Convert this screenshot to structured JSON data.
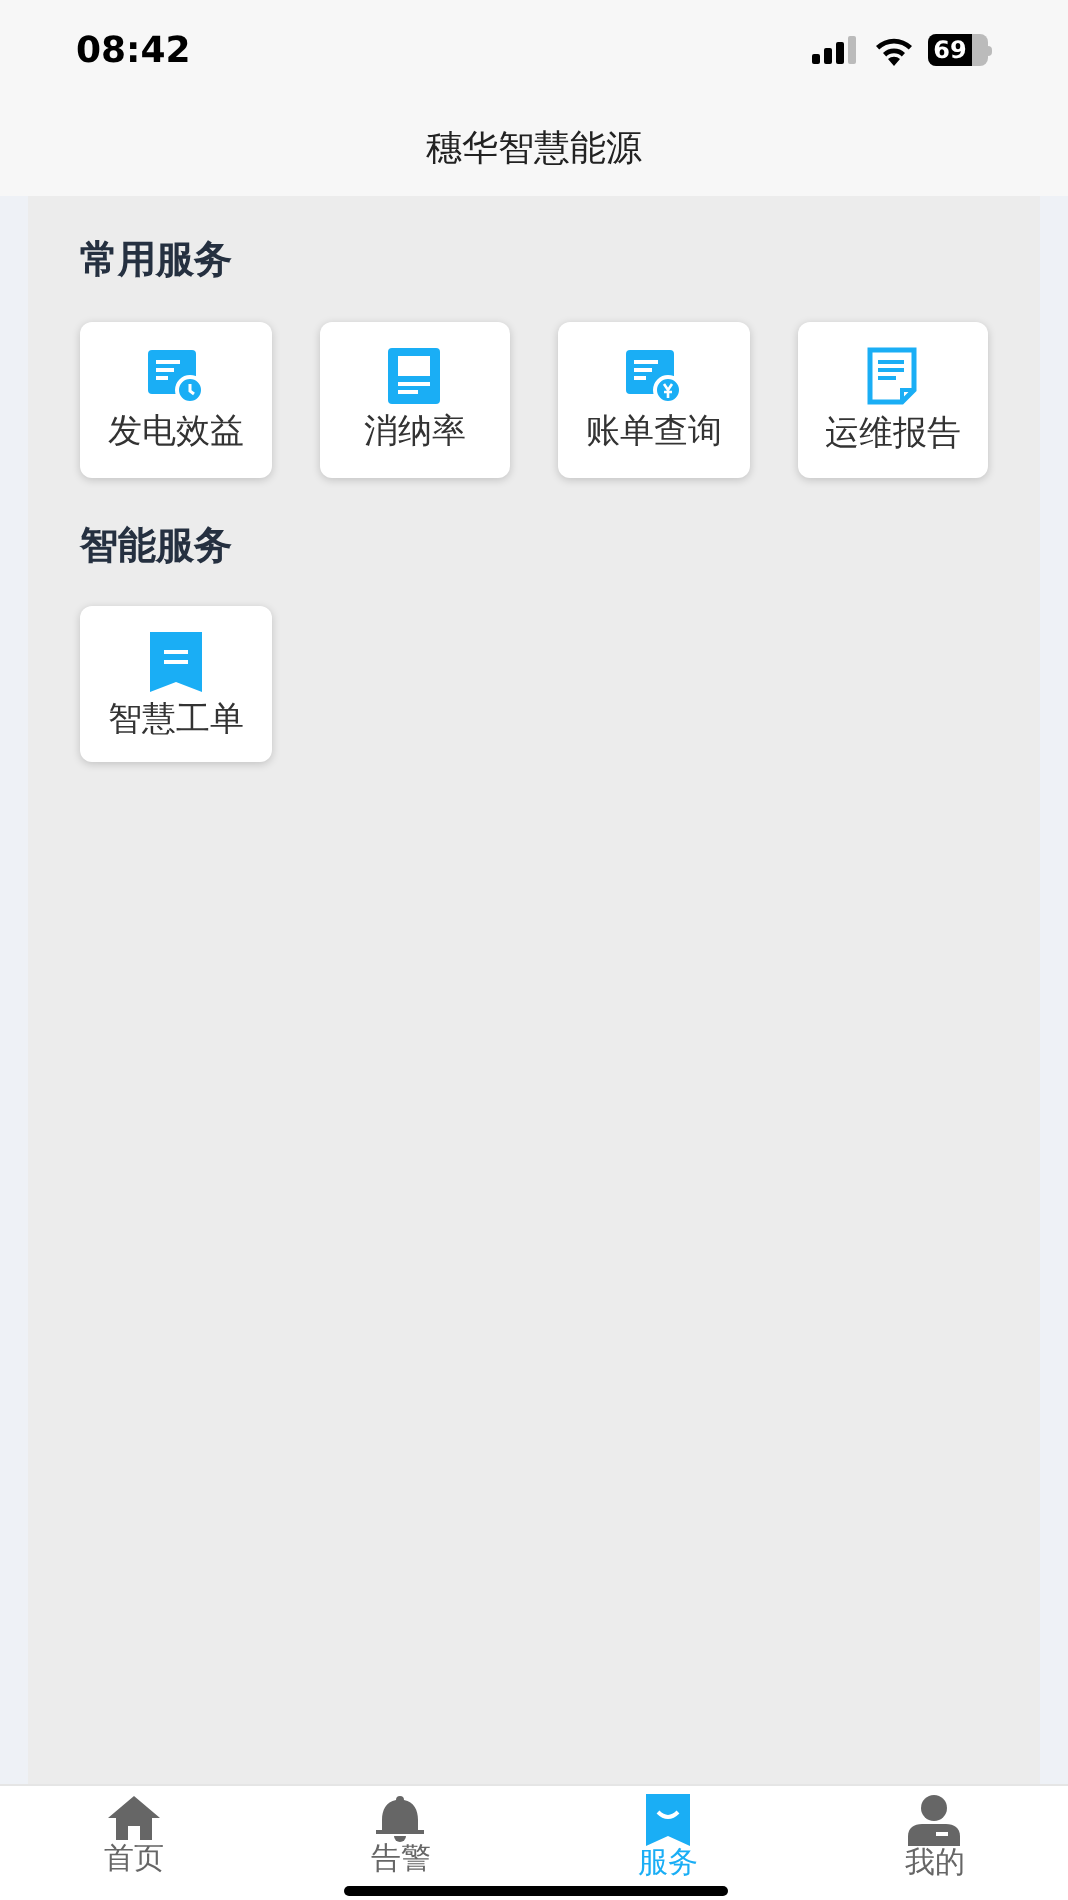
{
  "status_bar": {
    "time": "08:42",
    "battery": "69"
  },
  "header": {
    "title": "穗华智慧能源"
  },
  "sections": [
    {
      "title": "常用服务",
      "items": [
        {
          "label": "发电效益",
          "kind": "doc-clock"
        },
        {
          "label": "消纳率",
          "kind": "book"
        },
        {
          "label": "账单查询",
          "kind": "doc-yen"
        },
        {
          "label": "运维报告",
          "kind": "report"
        }
      ]
    },
    {
      "title": "智能服务",
      "items": [
        {
          "label": "智慧工单",
          "kind": "bookmark"
        }
      ]
    }
  ],
  "tab_bar": [
    {
      "label": "首页",
      "kind": "home",
      "selected": false
    },
    {
      "label": "告警",
      "kind": "bell",
      "selected": false
    },
    {
      "label": "服务",
      "kind": "service",
      "selected": true
    },
    {
      "label": "我的",
      "kind": "user",
      "selected": false
    }
  ]
}
